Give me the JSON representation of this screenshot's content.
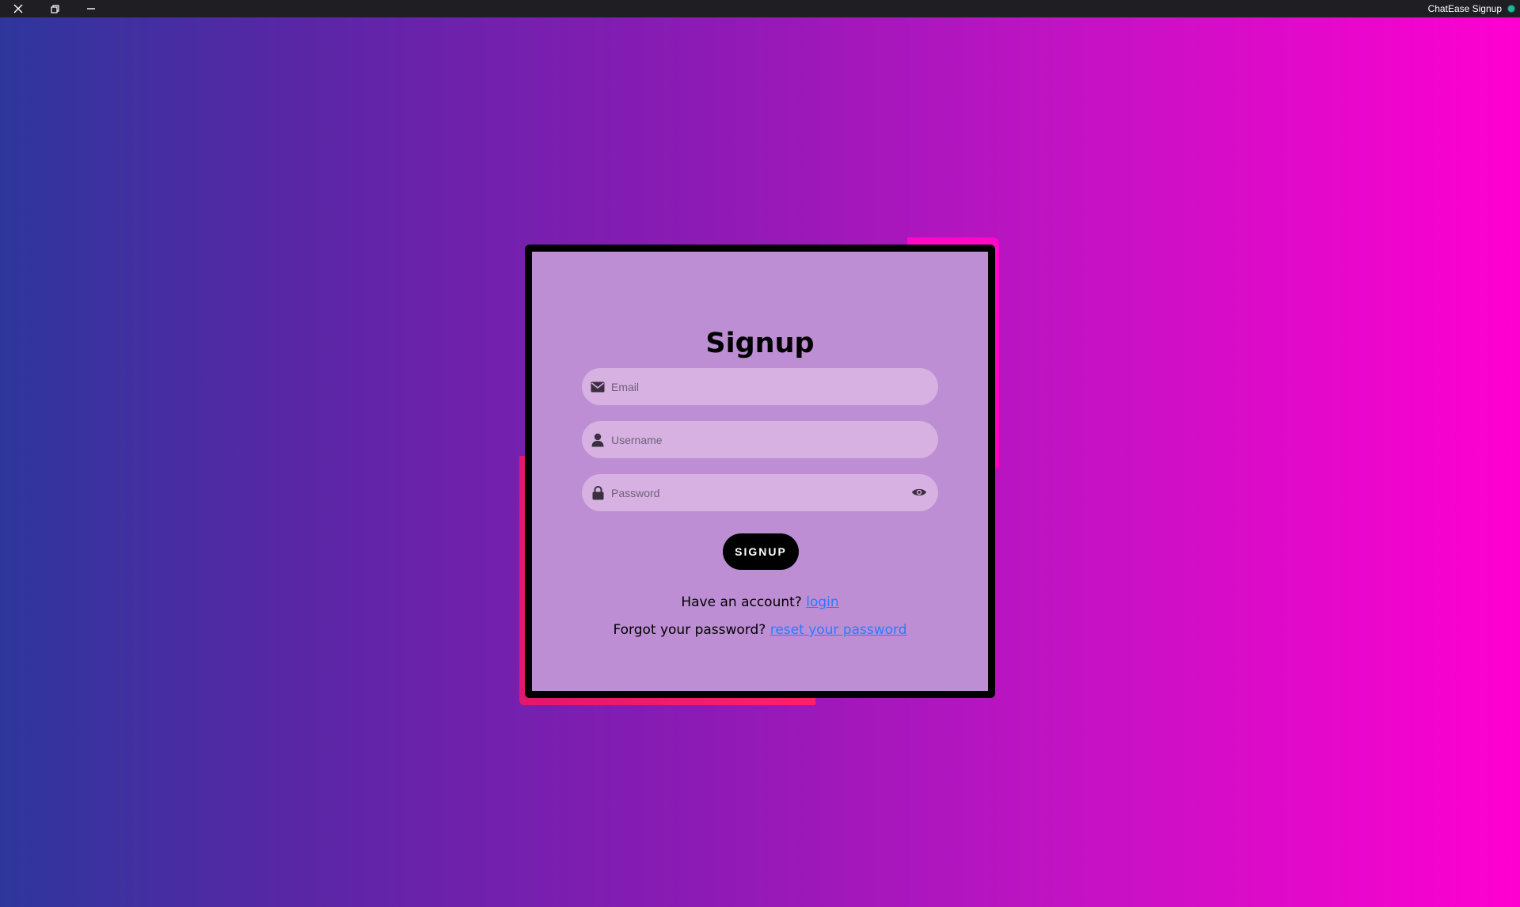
{
  "window": {
    "title": "ChatEase Signup"
  },
  "form": {
    "heading": "Signup",
    "email_placeholder": "Email",
    "username_placeholder": "Username",
    "password_placeholder": "Password",
    "submit_label": "SIGNUP",
    "login_prompt": "Have an account?",
    "login_link": "login",
    "reset_prompt": "Forgot your password?",
    "reset_link": "reset your password"
  },
  "colors": {
    "background_start": "#2e369c",
    "background_end": "#ff00d0",
    "card": "#bd8ed4",
    "field": "#d6b1e2",
    "link": "#2a7bff",
    "button": "#000000"
  },
  "icons": [
    "close-icon",
    "restore-icon",
    "minimize-icon",
    "envelope-icon",
    "user-icon",
    "lock-icon",
    "eye-icon"
  ]
}
